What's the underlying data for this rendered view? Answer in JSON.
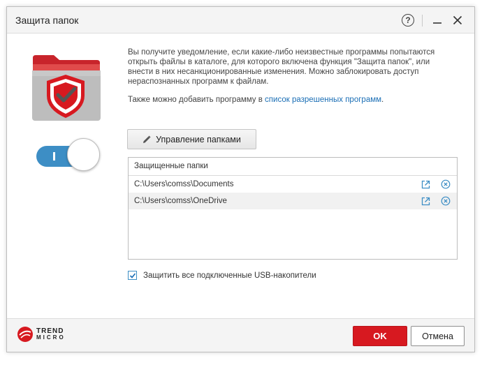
{
  "window": {
    "title": "Защита папок",
    "help_label": "?"
  },
  "description": {
    "paragraph": "Вы получите уведомление, если какие-либо неизвестные программы попытаются открыть файлы в каталоге, для которого включена функция \"Защита папок\", или внести в них несанкционированные изменения. Можно заблокировать доступ нераспознанных программ к файлам.",
    "also_prefix": "Также можно добавить программу в ",
    "allowed_link": "список разрешенных программ",
    "also_suffix": "."
  },
  "toggle": {
    "state": "on"
  },
  "manage_button": {
    "label": "Управление папками"
  },
  "protected_folders": {
    "header": "Защищенные папки",
    "rows": [
      {
        "path": "C:\\Users\\comss\\Documents"
      },
      {
        "path": "C:\\Users\\comss\\OneDrive"
      }
    ]
  },
  "usb": {
    "checked": true,
    "label": "Защитить все подключенные USB-накопители"
  },
  "footer": {
    "logo_line1": "TREND",
    "logo_line2": "MICRO",
    "ok_label": "OK",
    "cancel_label": "Отмена"
  },
  "colors": {
    "accent_blue": "#3d8ec5",
    "link_blue": "#1a6eb5",
    "ok_red": "#d71920",
    "folder_red": "#c8242b"
  },
  "icons": [
    "help-icon",
    "minimize-icon",
    "close-icon",
    "folder-shield-icon",
    "pencil-icon",
    "open-external-icon",
    "remove-circle-icon",
    "checkmark-icon",
    "trend-micro-logo"
  ]
}
